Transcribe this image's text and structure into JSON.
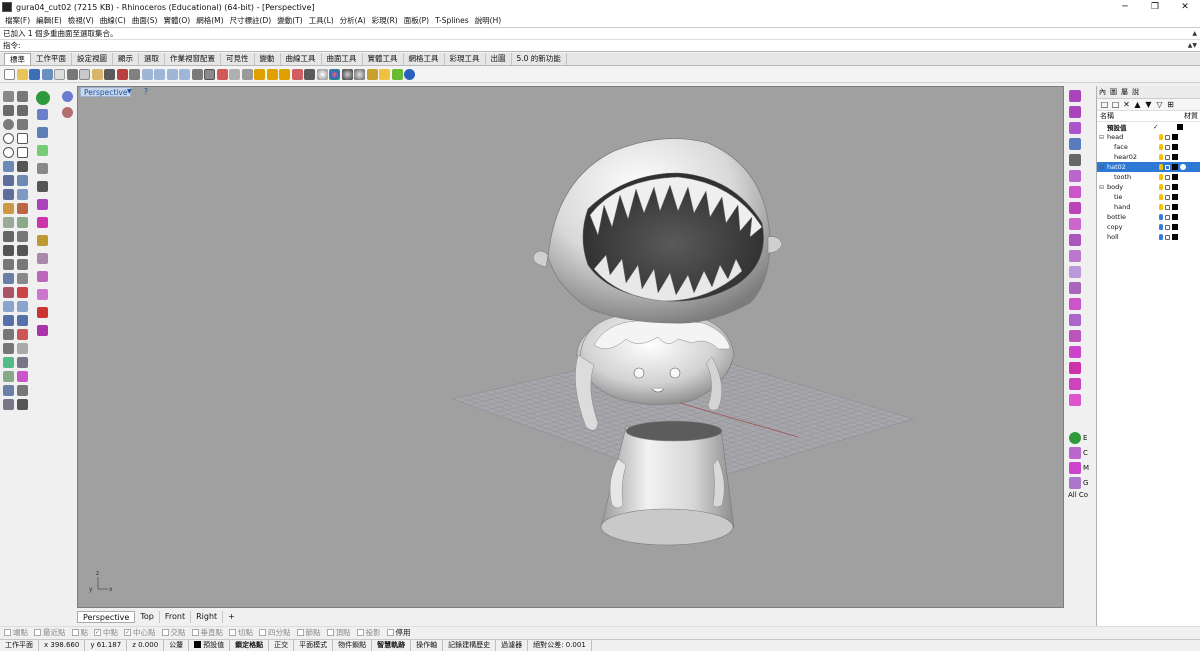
{
  "window": {
    "title": "gura04_cut02 (7215 KB) - Rhinoceros (Educational) (64-bit) - [Perspective]",
    "min_glyph": "─",
    "max_glyph": "❐",
    "close_glyph": "✕"
  },
  "menu": [
    "檔案(F)",
    "編輯(E)",
    "檢視(V)",
    "曲線(C)",
    "曲面(S)",
    "實體(O)",
    "網格(M)",
    "尺寸標註(D)",
    "變動(T)",
    "工具(L)",
    "分析(A)",
    "彩現(R)",
    "面板(P)",
    "T-Splines",
    "說明(H)"
  ],
  "command": {
    "history": "已加入 1 個多重曲面至選取集合。",
    "prompt": "指令:"
  },
  "toolbar_tabs": [
    "標準",
    "工作平面",
    "設定視圖",
    "顯示",
    "選取",
    "作業視窗配置",
    "可見性",
    "變動",
    "曲線工具",
    "曲面工具",
    "實體工具",
    "網格工具",
    "彩現工具",
    "出圖",
    "5.0 的新功能"
  ],
  "viewport": {
    "label": "Perspective",
    "help": "?",
    "axis_x": "x",
    "axis_y": "y",
    "axis_z": "z"
  },
  "view_tabs": [
    "Perspective",
    "Top",
    "Front",
    "Right"
  ],
  "view_tab_add": "+",
  "layers": {
    "tabs": [
      "內",
      "圖",
      "屬",
      "說"
    ],
    "tools": [
      "□",
      "□",
      "✕",
      "▲",
      "▼",
      "▽",
      "⊞"
    ],
    "col_name": "名稱",
    "col_material": "材質",
    "rows": [
      {
        "name": "預設值",
        "indent": 0,
        "expander": "",
        "current": "✓",
        "bulb": "",
        "selected": false
      },
      {
        "name": "head",
        "indent": 1,
        "expander": "⊟",
        "current": "",
        "bulb": "#f2c200",
        "selected": false
      },
      {
        "name": "face",
        "indent": 2,
        "expander": "",
        "current": "",
        "bulb": "#f2c200",
        "selected": false
      },
      {
        "name": "hear02",
        "indent": 2,
        "expander": "",
        "current": "",
        "bulb": "#f2c200",
        "selected": false
      },
      {
        "name": "hat02",
        "indent": 1,
        "expander": "⊟",
        "current": "",
        "bulb": "#f2c200",
        "selected": true
      },
      {
        "name": "tooth",
        "indent": 2,
        "expander": "",
        "current": "",
        "bulb": "#f2c200",
        "selected": false
      },
      {
        "name": "body",
        "indent": 1,
        "expander": "⊟",
        "current": "",
        "bulb": "#f2c200",
        "selected": false
      },
      {
        "name": "tie",
        "indent": 2,
        "expander": "",
        "current": "",
        "bulb": "#f2c200",
        "selected": false
      },
      {
        "name": "hand",
        "indent": 2,
        "expander": "",
        "current": "",
        "bulb": "#f2c200",
        "selected": false
      },
      {
        "name": "bottle",
        "indent": 1,
        "expander": "",
        "current": "",
        "bulb": "#3a7bd5",
        "selected": false
      },
      {
        "name": "copy",
        "indent": 1,
        "expander": "",
        "current": "",
        "bulb": "#3a7bd5",
        "selected": false
      },
      {
        "name": "holl",
        "indent": 1,
        "expander": "",
        "current": "",
        "bulb": "#3a7bd5",
        "selected": false
      }
    ]
  },
  "right_strip_labels": [
    "E",
    "C",
    "M",
    "G",
    "All Co"
  ],
  "osnap": [
    {
      "label": "端點",
      "checked": false
    },
    {
      "label": "最近點",
      "checked": false
    },
    {
      "label": "點",
      "checked": false
    },
    {
      "label": "中點",
      "checked": true
    },
    {
      "label": "中心點",
      "checked": true
    },
    {
      "label": "交點",
      "checked": false
    },
    {
      "label": "垂直點",
      "checked": false
    },
    {
      "label": "切點",
      "checked": false
    },
    {
      "label": "四分點",
      "checked": false
    },
    {
      "label": "節點",
      "checked": false
    },
    {
      "label": "頂點",
      "checked": false
    },
    {
      "label": "投影",
      "checked": false
    },
    {
      "label": "停用",
      "checked": false
    }
  ],
  "status": {
    "cplane": "工作平面",
    "x": "x 398.660",
    "y": "y 61.187",
    "z": "z 0.000",
    "units": "公釐",
    "layer": "預設值",
    "grid_snap": "鎖定格點",
    "ortho": "正交",
    "planar": "平面模式",
    "osnap": "物件鎖點",
    "smarttrack": "智慧軌跡",
    "gumball": "操作軸",
    "history": "記錄建構歷史",
    "filter": "過濾器",
    "tolerance": "絕對公差: 0.001"
  }
}
